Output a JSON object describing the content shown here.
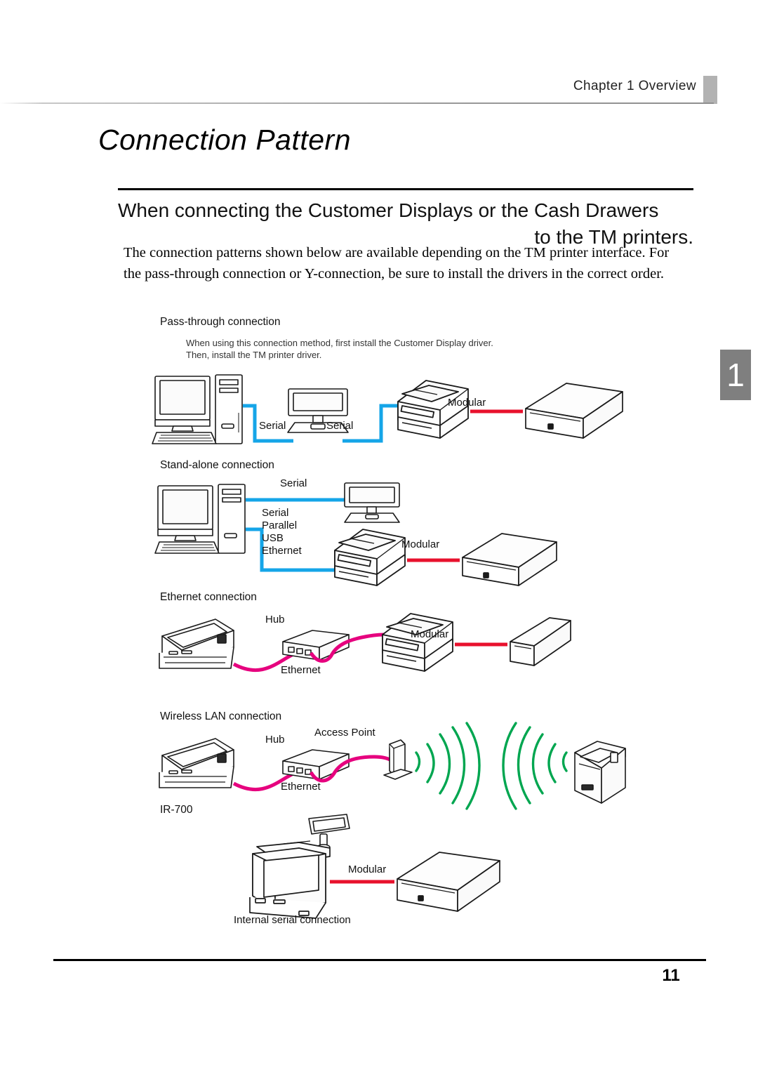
{
  "header": {
    "chapter": "Chapter 1   Overview",
    "side_tab_number": "1"
  },
  "title": "Connection Pattern",
  "section_heading": {
    "line1": "When connecting the Customer Displays or the Cash Drawers",
    "line2": "to the TM printers."
  },
  "body": {
    "paragraph": "The connection patterns shown below are available depending on the TM printer interface. For the pass-through connection or Y-connection, be sure to install the drivers in the correct order."
  },
  "diagrams": {
    "pass_through": {
      "title": "Pass-through connection",
      "note_line1": "When using this connection method, first install the Customer Display driver.",
      "note_line2": "Then, install the TM printer driver.",
      "cable_serial_1": "Serial",
      "cable_serial_2": "Serial",
      "cable_modular": "Modular"
    },
    "stand_alone": {
      "title": "Stand-alone connection",
      "cable_serial": "Serial",
      "interfaces": [
        "Serial",
        "Parallel",
        "USB",
        "Ethernet"
      ],
      "cable_modular": "Modular"
    },
    "ethernet": {
      "title": "Ethernet connection",
      "hub": "Hub",
      "cable_ethernet": "Ethernet",
      "cable_modular": "Modular"
    },
    "wireless": {
      "title": "Wireless LAN connection",
      "hub": "Hub",
      "access_point": "Access Point",
      "cable_ethernet": "Ethernet"
    },
    "ir700": {
      "title": "IR-700",
      "cable_modular": "Modular",
      "caption": "Internal serial connection"
    }
  },
  "footer": {
    "page_number": "11"
  },
  "colors": {
    "serial_cable": "#15a5e8",
    "modular_cable": "#e8112d",
    "ethernet_cable": "#e6007e",
    "wireless_wave": "#00a650",
    "tab_gray": "#7f7f7f"
  }
}
